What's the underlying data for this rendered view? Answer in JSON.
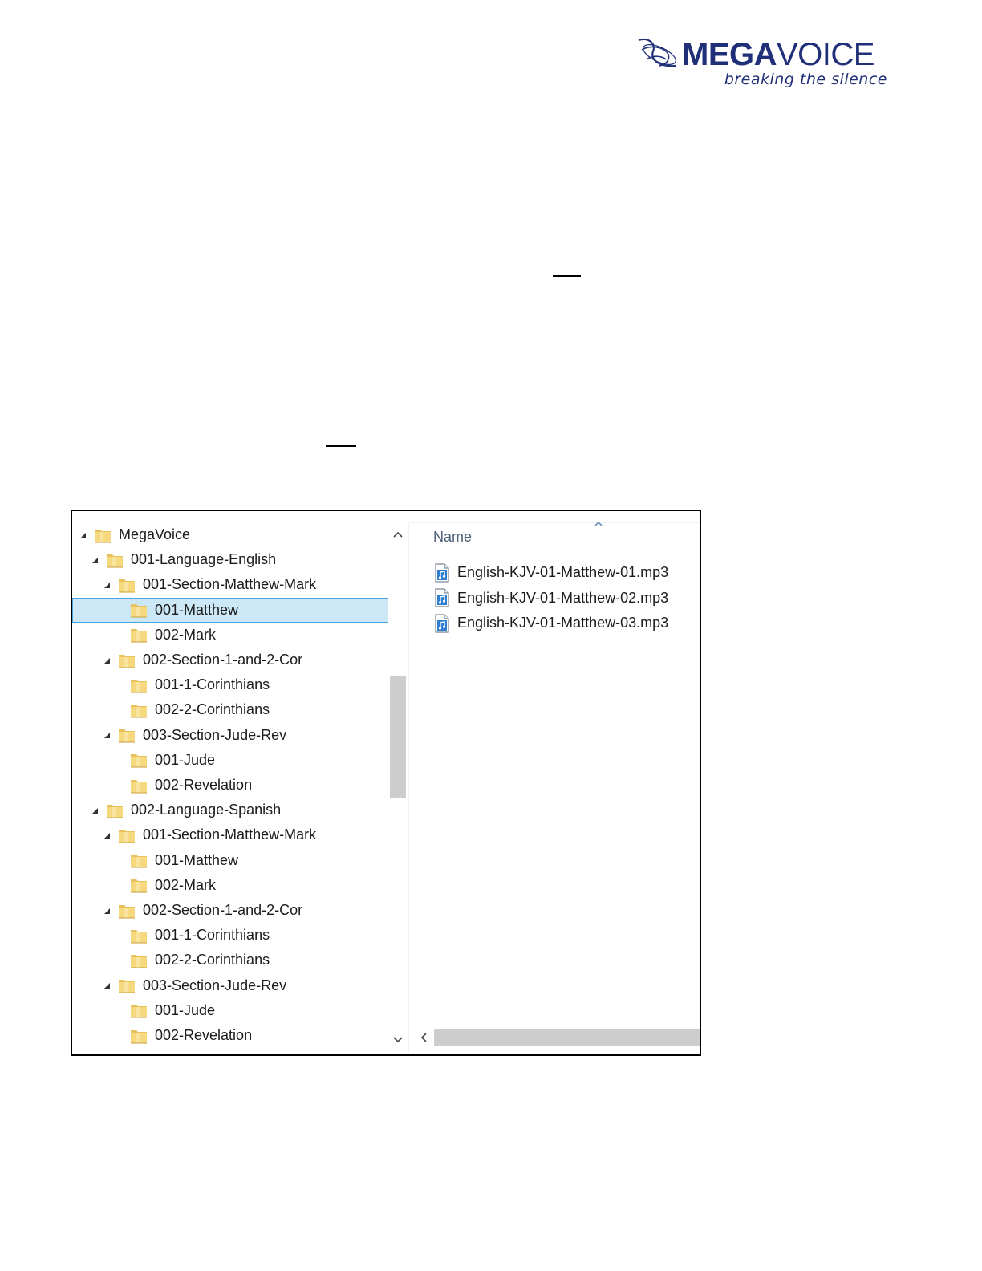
{
  "logo": {
    "brand_part1": "MEGA",
    "brand_part2": "VOICE",
    "tagline": "breaking the silence",
    "color": "#1f2f78"
  },
  "explorer": {
    "selected_color": "#cce8f6",
    "tree": [
      {
        "label": "MegaVoice",
        "level": 0,
        "expanded": true,
        "selected": false
      },
      {
        "label": "001-Language-English",
        "level": 1,
        "expanded": true,
        "selected": false
      },
      {
        "label": "001-Section-Matthew-Mark",
        "level": 2,
        "expanded": true,
        "selected": false
      },
      {
        "label": "001-Matthew",
        "level": 3,
        "expanded": null,
        "selected": true
      },
      {
        "label": "002-Mark",
        "level": 3,
        "expanded": null,
        "selected": false
      },
      {
        "label": "002-Section-1-and-2-Cor",
        "level": 2,
        "expanded": true,
        "selected": false
      },
      {
        "label": "001-1-Corinthians",
        "level": 3,
        "expanded": null,
        "selected": false
      },
      {
        "label": "002-2-Corinthians",
        "level": 3,
        "expanded": null,
        "selected": false
      },
      {
        "label": "003-Section-Jude-Rev",
        "level": 2,
        "expanded": true,
        "selected": false
      },
      {
        "label": "001-Jude",
        "level": 3,
        "expanded": null,
        "selected": false
      },
      {
        "label": "002-Revelation",
        "level": 3,
        "expanded": null,
        "selected": false
      },
      {
        "label": "002-Language-Spanish",
        "level": 1,
        "expanded": true,
        "selected": false
      },
      {
        "label": "001-Section-Matthew-Mark",
        "level": 2,
        "expanded": true,
        "selected": false
      },
      {
        "label": "001-Matthew",
        "level": 3,
        "expanded": null,
        "selected": false
      },
      {
        "label": "002-Mark",
        "level": 3,
        "expanded": null,
        "selected": false
      },
      {
        "label": "002-Section-1-and-2-Cor",
        "level": 2,
        "expanded": true,
        "selected": false
      },
      {
        "label": "001-1-Corinthians",
        "level": 3,
        "expanded": null,
        "selected": false
      },
      {
        "label": "002-2-Corinthians",
        "level": 3,
        "expanded": null,
        "selected": false
      },
      {
        "label": "003-Section-Jude-Rev",
        "level": 2,
        "expanded": true,
        "selected": false
      },
      {
        "label": "001-Jude",
        "level": 3,
        "expanded": null,
        "selected": false
      },
      {
        "label": "002-Revelation",
        "level": 3,
        "expanded": null,
        "selected": false
      }
    ],
    "file_list": {
      "column_header": "Name",
      "sort": "ascending",
      "files": [
        {
          "name": "English-KJV-01-Matthew-01.mp3",
          "icon": "audio-file-icon"
        },
        {
          "name": "English-KJV-01-Matthew-02.mp3",
          "icon": "audio-file-icon"
        },
        {
          "name": "English-KJV-01-Matthew-03.mp3",
          "icon": "audio-file-icon"
        }
      ]
    },
    "scroll_icons": {
      "up": "chevron-up-icon",
      "down": "chevron-down-icon",
      "left": "chevron-left-icon"
    }
  }
}
